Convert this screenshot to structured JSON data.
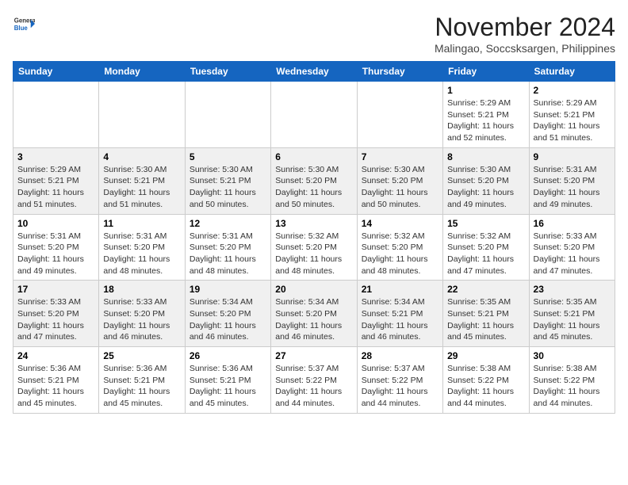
{
  "header": {
    "logo_general": "General",
    "logo_blue": "Blue",
    "month_year": "November 2024",
    "location": "Malingao, Soccsksargen, Philippines"
  },
  "days_of_week": [
    "Sunday",
    "Monday",
    "Tuesday",
    "Wednesday",
    "Thursday",
    "Friday",
    "Saturday"
  ],
  "weeks": [
    [
      {
        "day": "",
        "info": ""
      },
      {
        "day": "",
        "info": ""
      },
      {
        "day": "",
        "info": ""
      },
      {
        "day": "",
        "info": ""
      },
      {
        "day": "",
        "info": ""
      },
      {
        "day": "1",
        "info": "Sunrise: 5:29 AM\nSunset: 5:21 PM\nDaylight: 11 hours and 52 minutes."
      },
      {
        "day": "2",
        "info": "Sunrise: 5:29 AM\nSunset: 5:21 PM\nDaylight: 11 hours and 51 minutes."
      }
    ],
    [
      {
        "day": "3",
        "info": "Sunrise: 5:29 AM\nSunset: 5:21 PM\nDaylight: 11 hours and 51 minutes."
      },
      {
        "day": "4",
        "info": "Sunrise: 5:30 AM\nSunset: 5:21 PM\nDaylight: 11 hours and 51 minutes."
      },
      {
        "day": "5",
        "info": "Sunrise: 5:30 AM\nSunset: 5:21 PM\nDaylight: 11 hours and 50 minutes."
      },
      {
        "day": "6",
        "info": "Sunrise: 5:30 AM\nSunset: 5:20 PM\nDaylight: 11 hours and 50 minutes."
      },
      {
        "day": "7",
        "info": "Sunrise: 5:30 AM\nSunset: 5:20 PM\nDaylight: 11 hours and 50 minutes."
      },
      {
        "day": "8",
        "info": "Sunrise: 5:30 AM\nSunset: 5:20 PM\nDaylight: 11 hours and 49 minutes."
      },
      {
        "day": "9",
        "info": "Sunrise: 5:31 AM\nSunset: 5:20 PM\nDaylight: 11 hours and 49 minutes."
      }
    ],
    [
      {
        "day": "10",
        "info": "Sunrise: 5:31 AM\nSunset: 5:20 PM\nDaylight: 11 hours and 49 minutes."
      },
      {
        "day": "11",
        "info": "Sunrise: 5:31 AM\nSunset: 5:20 PM\nDaylight: 11 hours and 48 minutes."
      },
      {
        "day": "12",
        "info": "Sunrise: 5:31 AM\nSunset: 5:20 PM\nDaylight: 11 hours and 48 minutes."
      },
      {
        "day": "13",
        "info": "Sunrise: 5:32 AM\nSunset: 5:20 PM\nDaylight: 11 hours and 48 minutes."
      },
      {
        "day": "14",
        "info": "Sunrise: 5:32 AM\nSunset: 5:20 PM\nDaylight: 11 hours and 48 minutes."
      },
      {
        "day": "15",
        "info": "Sunrise: 5:32 AM\nSunset: 5:20 PM\nDaylight: 11 hours and 47 minutes."
      },
      {
        "day": "16",
        "info": "Sunrise: 5:33 AM\nSunset: 5:20 PM\nDaylight: 11 hours and 47 minutes."
      }
    ],
    [
      {
        "day": "17",
        "info": "Sunrise: 5:33 AM\nSunset: 5:20 PM\nDaylight: 11 hours and 47 minutes."
      },
      {
        "day": "18",
        "info": "Sunrise: 5:33 AM\nSunset: 5:20 PM\nDaylight: 11 hours and 46 minutes."
      },
      {
        "day": "19",
        "info": "Sunrise: 5:34 AM\nSunset: 5:20 PM\nDaylight: 11 hours and 46 minutes."
      },
      {
        "day": "20",
        "info": "Sunrise: 5:34 AM\nSunset: 5:20 PM\nDaylight: 11 hours and 46 minutes."
      },
      {
        "day": "21",
        "info": "Sunrise: 5:34 AM\nSunset: 5:21 PM\nDaylight: 11 hours and 46 minutes."
      },
      {
        "day": "22",
        "info": "Sunrise: 5:35 AM\nSunset: 5:21 PM\nDaylight: 11 hours and 45 minutes."
      },
      {
        "day": "23",
        "info": "Sunrise: 5:35 AM\nSunset: 5:21 PM\nDaylight: 11 hours and 45 minutes."
      }
    ],
    [
      {
        "day": "24",
        "info": "Sunrise: 5:36 AM\nSunset: 5:21 PM\nDaylight: 11 hours and 45 minutes."
      },
      {
        "day": "25",
        "info": "Sunrise: 5:36 AM\nSunset: 5:21 PM\nDaylight: 11 hours and 45 minutes."
      },
      {
        "day": "26",
        "info": "Sunrise: 5:36 AM\nSunset: 5:21 PM\nDaylight: 11 hours and 45 minutes."
      },
      {
        "day": "27",
        "info": "Sunrise: 5:37 AM\nSunset: 5:22 PM\nDaylight: 11 hours and 44 minutes."
      },
      {
        "day": "28",
        "info": "Sunrise: 5:37 AM\nSunset: 5:22 PM\nDaylight: 11 hours and 44 minutes."
      },
      {
        "day": "29",
        "info": "Sunrise: 5:38 AM\nSunset: 5:22 PM\nDaylight: 11 hours and 44 minutes."
      },
      {
        "day": "30",
        "info": "Sunrise: 5:38 AM\nSunset: 5:22 PM\nDaylight: 11 hours and 44 minutes."
      }
    ]
  ]
}
